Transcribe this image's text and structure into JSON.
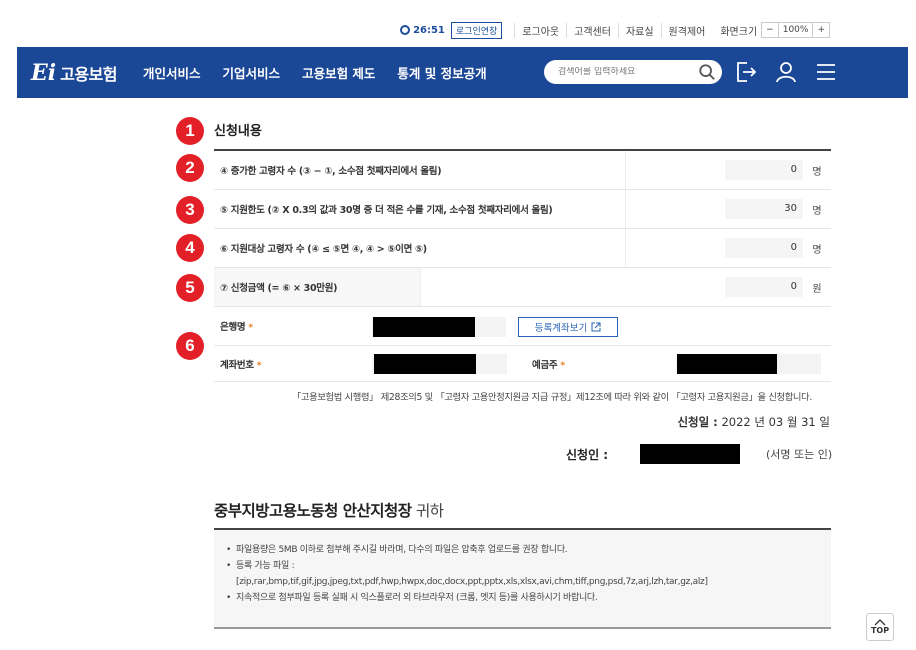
{
  "util": {
    "timer": "26:51",
    "extend_label": "로그인연장",
    "links": [
      "로그아웃",
      "고객센터",
      "자료실",
      "원격제어"
    ],
    "zoom_label": "화면크기",
    "zoom_minus": "−",
    "zoom_value": "100%",
    "zoom_plus": "+"
  },
  "nav": {
    "logo_mark": "Ei",
    "logo_text": "고용보험",
    "menu": [
      "개인서비스",
      "기업서비스",
      "고용보험 제도",
      "통계 및 정보공개"
    ],
    "search_placeholder": "검색어를 입력하세요"
  },
  "colors": {
    "nav_bg": "#1b4797",
    "badge": "#e32027",
    "required": "#e87b1c",
    "link": "#2a63b3"
  },
  "section": {
    "title": "신청내용",
    "badges": [
      "1",
      "2",
      "3",
      "4",
      "5",
      "6"
    ],
    "rows": [
      {
        "label": "④ 증가한 고령자 수 (③ − ①, 소수점 첫째자리에서 올림)",
        "value": "0",
        "unit": "명"
      },
      {
        "label": "⑤ 지원한도 (② X 0.3의 값과 30명 중 더 적은 수를 기재, 소수점 첫째자리에서 올림)",
        "value": "30",
        "unit": "명"
      },
      {
        "label": "⑥ 지원대상 고령자 수 (④ ≤ ⑤면 ④,   ④ > ⑤이면 ⑤)",
        "value": "0",
        "unit": "명"
      },
      {
        "label": "⑦ 신청금액 (= ⑥ × 30만원)",
        "value": "0",
        "unit": "원"
      }
    ],
    "bank_label": "은행명",
    "account_btn": "등록계좌보기",
    "account_label": "계좌번호",
    "holder_label": "예금주",
    "required_mark": "*"
  },
  "legal_text": "「고용보험법 시행령」 제28조의5 및 「고령자 고용안정지원금 지급 규정」제12조에 따라 위와 같이 「고령자 고용지원금」을 신청합니다.",
  "date": {
    "label": "신청일 :",
    "value": "2022 년 03 월 31 일"
  },
  "applicant": {
    "label": "신청인 :",
    "sign": "(서명 또는 인)"
  },
  "office": {
    "name": "중부지방고용노동청 안산지청장",
    "suffix": "귀하"
  },
  "notice": [
    "파일용량은 5MB 이하로 첨부해 주시길 바라며, 다수의 파일은 압축후 업로드를 권장 합니다.",
    "등록 가능 파일 :",
    "[zip,rar,bmp,tif,gif,jpg,jpeg,txt,pdf,hwp,hwpx,doc,docx,ppt,pptx,xls,xlsx,avi,chm,tiff,png,psd,7z,arj,lzh,tar,gz,alz]",
    "지속적으로 첨부파일 등록 실패 시 익스플로러 외 타브라우저 (크롬, 엣지 등)를 사용하시기 바랍니다."
  ],
  "top_label": "TOP"
}
